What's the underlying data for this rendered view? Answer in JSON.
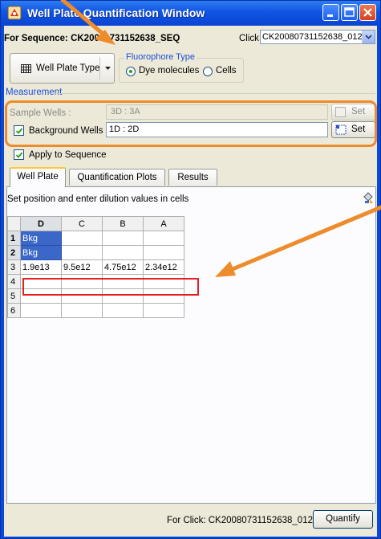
{
  "window": {
    "title": "Well Plate Quantification Window",
    "titlebar_color": "#0a49d8"
  },
  "sequence": {
    "label": "For Sequence: CK20080731152638_SEQ",
    "click_label": "Click",
    "click_value": "CK20080731152638_012"
  },
  "toolbar": {
    "well_plate_type_label": "Well Plate Type"
  },
  "fluorophore": {
    "title": "Fluorophore Type",
    "options": [
      "Dye molecules",
      "Cells"
    ],
    "selected": "Dye molecules"
  },
  "measurement": {
    "title": "Measurement",
    "sample_wells_label": "Sample Wells :",
    "sample_wells_value": "3D : 3A",
    "sample_set_label": "Set",
    "background_wells_label": "Background Wells",
    "background_wells_value": "1D : 2D",
    "background_set_label": "Set",
    "background_checked": true,
    "sample_checked": false
  },
  "apply": {
    "label": "Apply to Sequence",
    "checked": true
  },
  "tabs": [
    {
      "label": "Well Plate",
      "active": true
    },
    {
      "label": "Quantification Plots",
      "active": false
    },
    {
      "label": "Results",
      "active": false
    }
  ],
  "panel": {
    "hint": "Set position and enter dilution values in cells"
  },
  "grid": {
    "columns": [
      "D",
      "C",
      "B",
      "A"
    ],
    "rows": [
      {
        "label": "1",
        "cells": [
          "Bkg",
          "",
          "",
          ""
        ]
      },
      {
        "label": "2",
        "cells": [
          "Bkg",
          "",
          "",
          ""
        ]
      },
      {
        "label": "3",
        "cells": [
          "1.9e13",
          "9.5e12",
          "4.75e12",
          "2.34e12"
        ]
      },
      {
        "label": "4",
        "cells": [
          "",
          "",
          "",
          ""
        ]
      },
      {
        "label": "5",
        "cells": [
          "",
          "",
          "",
          ""
        ]
      },
      {
        "label": "6",
        "cells": [
          "",
          "",
          "",
          ""
        ]
      }
    ]
  },
  "footer": {
    "for_click": "For Click: CK20080731152638_012",
    "quantify_label": "Quantify"
  },
  "colors": {
    "annotation_orange": "#ee8b2a",
    "highlight_red": "#e51f1f",
    "bkg_cell": "#3a67c8"
  }
}
